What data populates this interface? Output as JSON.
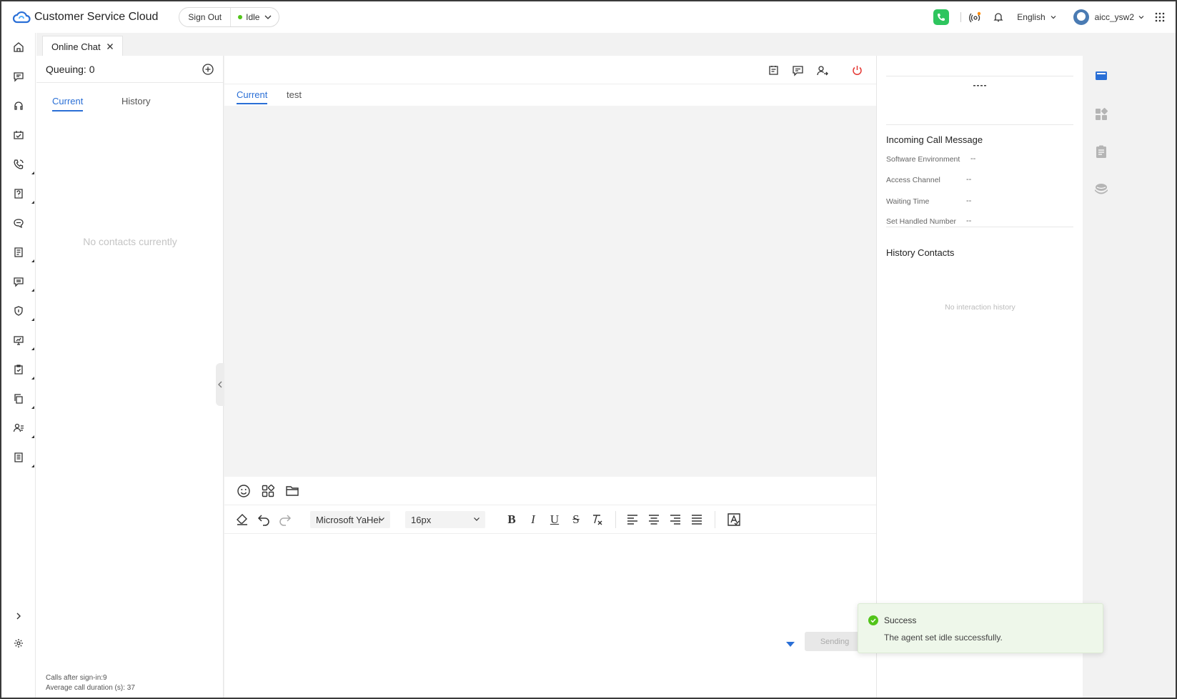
{
  "app": {
    "title": "Customer Service Cloud"
  },
  "header": {
    "sign_out": "Sign Out",
    "status": "Idle",
    "language": "English",
    "username": "aicc_ysw2"
  },
  "tab": {
    "label": "Online Chat"
  },
  "left_panel": {
    "queuing": "Queuing: 0",
    "tabs": [
      "Current",
      "History"
    ],
    "empty": "No contacts currently",
    "stats": [
      "Calls after sign-in:9",
      "Average call duration (s): 37"
    ]
  },
  "chat": {
    "tabs": [
      "Current",
      "test"
    ],
    "font": "Microsoft YaHei",
    "size": "16px",
    "send": "Sending"
  },
  "info": {
    "dash": "----",
    "incoming_title": "Incoming Call Message",
    "rows": [
      {
        "label": "Software Environment",
        "value": "--"
      },
      {
        "label": "Access Channel",
        "value": "--"
      },
      {
        "label": "Waiting Time",
        "value": "--"
      },
      {
        "label": "Set Handled Number",
        "value": "--"
      }
    ],
    "history_title": "History Contacts",
    "history_empty": "No interaction history"
  },
  "toast": {
    "title": "Success",
    "message": "The agent set idle successfully."
  },
  "colors": {
    "accent": "#2a6fd6",
    "success": "#52c41a",
    "phone": "#2ec55e",
    "hangup": "#e53935"
  }
}
